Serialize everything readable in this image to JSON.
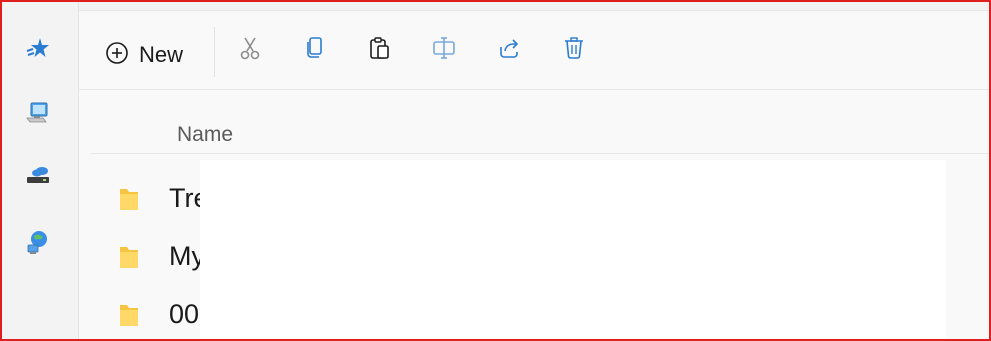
{
  "rail": {
    "items": [
      {
        "icon": "quick-access-icon"
      },
      {
        "icon": "this-pc-icon"
      },
      {
        "icon": "cloud-drive-icon"
      },
      {
        "icon": "network-icon"
      }
    ]
  },
  "toolbar": {
    "new_label": "New",
    "buttons": [
      {
        "icon": "cut-icon"
      },
      {
        "icon": "copy-icon"
      },
      {
        "icon": "paste-icon"
      },
      {
        "icon": "rename-icon"
      },
      {
        "icon": "share-icon"
      },
      {
        "icon": "delete-icon"
      }
    ]
  },
  "list": {
    "header_name": "Name",
    "rows": [
      {
        "label": "Tre"
      },
      {
        "label": "My"
      },
      {
        "label": "00"
      }
    ]
  },
  "colors": {
    "accent": "#2b7cd3",
    "folder": "#f5c542",
    "frame": "#e02020"
  }
}
